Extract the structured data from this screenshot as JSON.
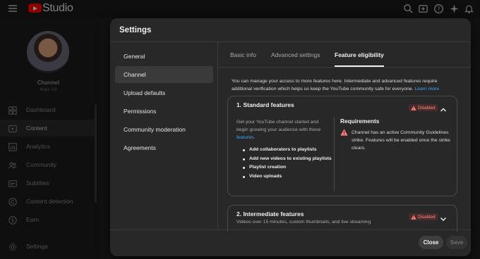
{
  "app": {
    "name": "Studio"
  },
  "topbar": {
    "icons": [
      "menu-icon",
      "youtube-logo",
      "search-icon",
      "create-icon",
      "help-icon",
      "sparkle-icon",
      "bell-icon"
    ]
  },
  "sidebar": {
    "channel_title": "Channel",
    "channel_name": "Malik Atif",
    "items": [
      {
        "label": "Dashboard",
        "icon": "dashboard-icon"
      },
      {
        "label": "Content",
        "icon": "content-icon",
        "active": true
      },
      {
        "label": "Analytics",
        "icon": "analytics-icon"
      },
      {
        "label": "Community",
        "icon": "community-icon"
      },
      {
        "label": "Subtitles",
        "icon": "subtitles-icon"
      },
      {
        "label": "Content detection",
        "icon": "copyright-icon"
      },
      {
        "label": "Earn",
        "icon": "dollar-icon"
      },
      {
        "label": "Settings",
        "icon": "gear-icon"
      }
    ]
  },
  "modal": {
    "title": "Settings",
    "nav": [
      "General",
      "Channel",
      "Upload defaults",
      "Permissions",
      "Community moderation",
      "Agreements"
    ],
    "active_nav": "Channel",
    "tabs": [
      "Basic info",
      "Advanced settings",
      "Feature eligibility"
    ],
    "active_tab": "Feature eligibility",
    "intro": "You can manage your access to more features here. Intermediate and advanced features require additional verification which helps us keep the YouTube community safe for everyone.",
    "learn_more": "Learn more",
    "standard": {
      "title": "1. Standard features",
      "status": "Disabled",
      "desc": "Get your YouTube channel started and begin growing your audience with these",
      "desc_link": "features.",
      "features": [
        "Add collaborators to playlists",
        "Add new videos to existing playlists",
        "Playlist creation",
        "Video uploads"
      ],
      "requirements_title": "Requirements",
      "requirement": "Channel has an active Community Guidelines strike. Features will be enabled once the strike clears."
    },
    "intermediate": {
      "title": "2. Intermediate features",
      "status": "Disabled",
      "desc": "Videos over 15 minutes, custom thumbnails, and live streaming"
    },
    "buttons": {
      "close": "Close",
      "save": "Save"
    }
  },
  "colors": {
    "accent_link": "#3ea6ff",
    "disabled_badge": "#ff8a80",
    "brand_red": "#ff0000"
  }
}
